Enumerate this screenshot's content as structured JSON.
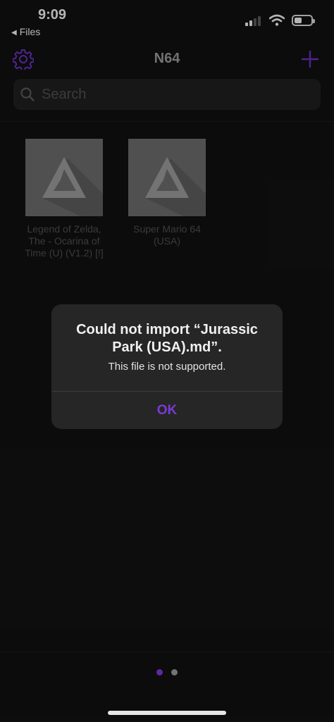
{
  "status_bar": {
    "time": "9:09",
    "back_label": "Files",
    "battery_level": 0.45,
    "signal_bars": 2
  },
  "nav": {
    "title": "N64",
    "settings_icon": "gear-icon",
    "add_icon": "plus-icon"
  },
  "search": {
    "placeholder": "Search",
    "value": ""
  },
  "games": [
    {
      "title": "Legend of Zelda, The - Ocarina of Time (U) (V1.2) [!]",
      "art_icon": "delta-logo-icon"
    },
    {
      "title": "Super Mario 64 (USA)",
      "art_icon": "delta-logo-icon"
    }
  ],
  "alert": {
    "title": "Could not import “Jurassic Park (USA).md”.",
    "message": "This file is not supported.",
    "ok_label": "OK"
  },
  "pagination": {
    "page_count": 2,
    "current_page": 1
  },
  "colors": {
    "accent": "#7a3ad6",
    "background": "#111111",
    "alert_background": "#262626",
    "inactive_dot": "#9a9a9a"
  }
}
